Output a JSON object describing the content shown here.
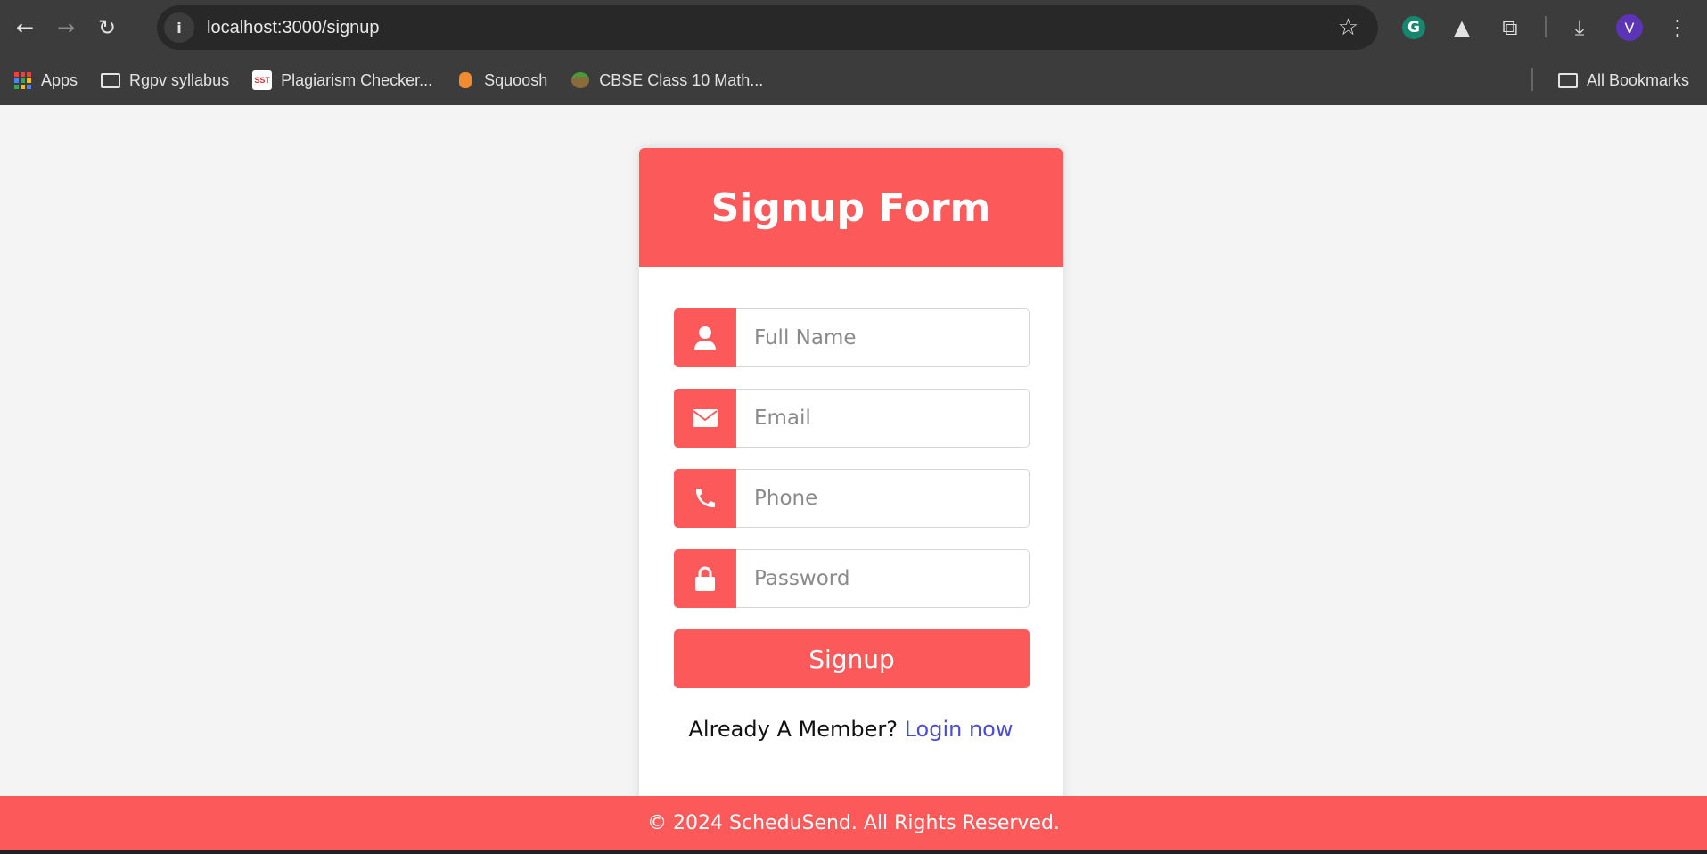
{
  "browser": {
    "url": "localhost:3000/signup",
    "profile_initial": "V",
    "bookmarks": [
      {
        "label": "Apps",
        "icon": "apps-grid-icon"
      },
      {
        "label": "Rgpv syllabus",
        "icon": "folder-icon"
      },
      {
        "label": "Plagiarism Checker...",
        "icon": "sst-favicon",
        "badge": "SST"
      },
      {
        "label": "Squoosh",
        "icon": "squoosh-favicon"
      },
      {
        "label": "CBSE Class 10 Math...",
        "icon": "cbse-favicon"
      }
    ],
    "all_bookmarks": "All Bookmarks"
  },
  "form": {
    "title": "Signup Form",
    "fields": [
      {
        "placeholder": "Full Name",
        "value": "",
        "icon": "user-icon"
      },
      {
        "placeholder": "Email",
        "value": "",
        "icon": "envelope-icon"
      },
      {
        "placeholder": "Phone",
        "value": "",
        "icon": "phone-icon"
      },
      {
        "placeholder": "Password",
        "value": "",
        "icon": "lock-icon"
      }
    ],
    "submit_label": "Signup",
    "member_text": "Already A Member?",
    "login_link": "Login now"
  },
  "footer": {
    "text": "© 2024 ScheduSend. All Rights Reserved."
  },
  "colors": {
    "accent": "#fc5a5a",
    "link": "#4b4bd6",
    "background": "#f4f4f4"
  }
}
